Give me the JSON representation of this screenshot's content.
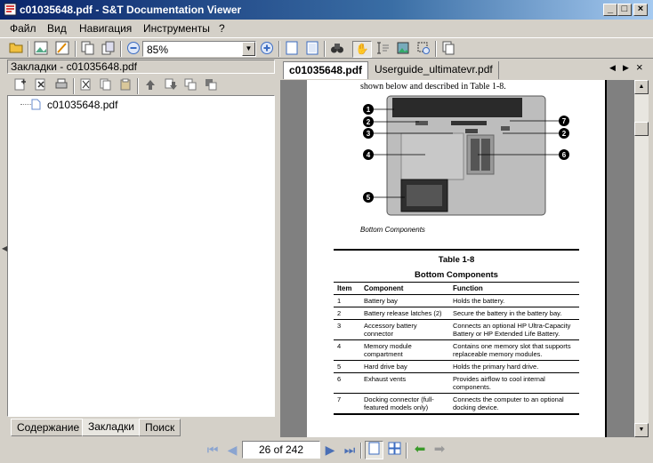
{
  "window": {
    "title": "c01035648.pdf - S&T Documentation Viewer"
  },
  "menu": [
    "Файл",
    "Вид",
    "Навигация",
    "Инструменты",
    "?"
  ],
  "toolbar": {
    "zoom": "85%"
  },
  "left_panel": {
    "title": "Закладки - c01035648.pdf",
    "tree_item": "c01035648.pdf",
    "tabs": [
      "Содержание",
      "Закладки",
      "Поиск"
    ]
  },
  "doc_tabs": [
    "c01035648.pdf",
    "Userguide_ultimatevr.pdf"
  ],
  "document": {
    "intro_text": "shown below and described in Table 1-8.",
    "figure_caption": "Bottom Components",
    "callouts": [
      "1",
      "2",
      "3",
      "4",
      "5",
      "7",
      "2",
      "6"
    ],
    "table_title": "Table 1-8",
    "table_subtitle": "Bottom Components",
    "columns": [
      "Item",
      "Component",
      "Function"
    ],
    "rows": [
      [
        "1",
        "Battery bay",
        "Holds the battery."
      ],
      [
        "2",
        "Battery release latches (2)",
        "Secure the battery in the battery bay."
      ],
      [
        "3",
        "Accessory battery connector",
        "Connects an optional HP Ultra-Capacity Battery or HP Extended Life Battery."
      ],
      [
        "4",
        "Memory module compartment",
        "Contains one memory slot that supports replaceable memory modules."
      ],
      [
        "5",
        "Hard drive bay",
        "Holds the primary hard drive."
      ],
      [
        "6",
        "Exhaust vents",
        "Provides airflow to cool internal components."
      ],
      [
        "7",
        "Docking connector (full-featured models only)",
        "Connects the computer to an optional docking device."
      ]
    ]
  },
  "navigation": {
    "page_indicator": "26 of 242"
  }
}
